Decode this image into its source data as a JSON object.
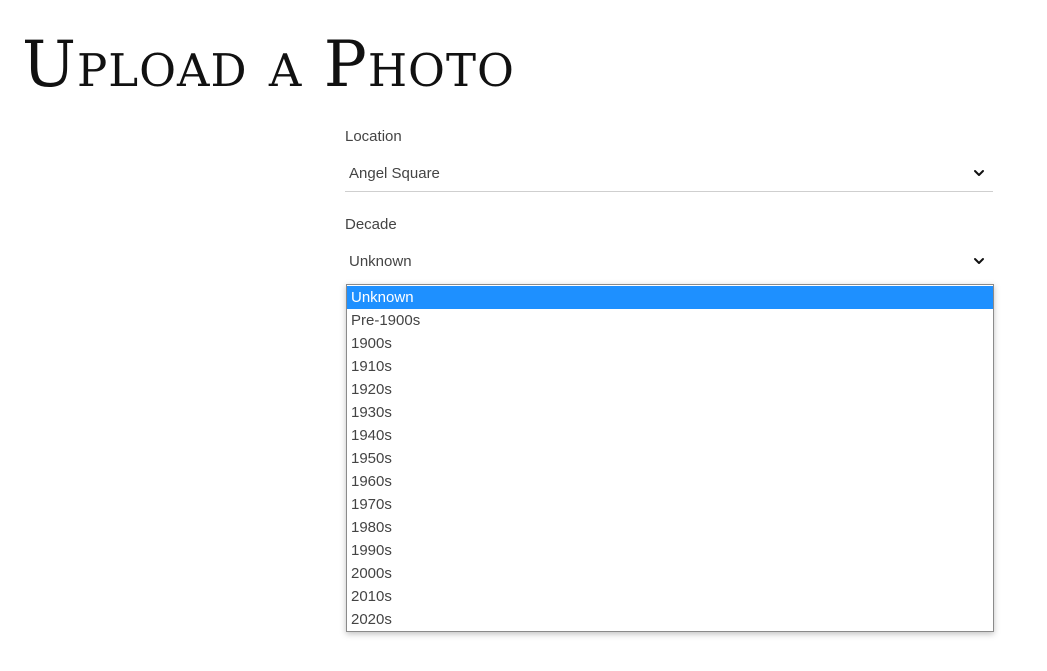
{
  "page": {
    "title": "Upload a Photo"
  },
  "location": {
    "label": "Location",
    "value": "Angel Square",
    "icon": "chevron-down-icon"
  },
  "decade": {
    "label": "Decade",
    "value": "Unknown",
    "icon": "chevron-down-icon",
    "options": [
      "Unknown",
      "Pre-1900s",
      "1900s",
      "1910s",
      "1920s",
      "1930s",
      "1940s",
      "1950s",
      "1960s",
      "1970s",
      "1980s",
      "1990s",
      "2000s",
      "2010s",
      "2020s"
    ],
    "selected_option": "Unknown"
  },
  "colors": {
    "highlight": "#1e90ff",
    "text": "#444444",
    "title": "#111111",
    "divider": "#cfcfcf"
  }
}
